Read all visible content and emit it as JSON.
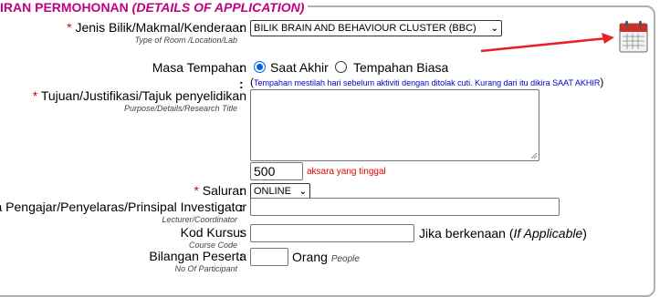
{
  "section": {
    "title": "IRAN PERMOHONAN",
    "title_en": "(DETAILS OF APPLICATION)"
  },
  "fields": {
    "room": {
      "label": "Jenis Bilik/Makmal/Kenderaan",
      "sublabel": "Type of Room /Location/Lab",
      "value": "BILIK BRAIN AND BEHAVIOUR CLUSTER (BBC)"
    },
    "booking": {
      "label": "Masa Tempahan",
      "option1": "Saat Akhir",
      "option2": "Tempahan Biasa",
      "selected": "Saat Akhir",
      "note_open": "(",
      "note": "Tempahan mestilah hari sebelum aktiviti dengan ditolak cuti. Kurang dari itu dikira SAAT AKHIR",
      "note_close": ")"
    },
    "purpose": {
      "label": "Tujuan/Justifikasi/Tajuk penyelidikan",
      "sublabel": "Purpose/Details/Research Title",
      "value": "",
      "chars_left": "500",
      "chars_label": "aksara yang tinggal"
    },
    "channel": {
      "label": "Saluran",
      "value": "ONLINE"
    },
    "lecturer": {
      "label": "a Pengajar/Penyelaras/Prinsipal Investigator",
      "sublabel": "Lecturer/Coordinator",
      "value": ""
    },
    "course": {
      "label": "Kod Kursus",
      "sublabel": "Course Code",
      "value": "",
      "suffix": "Jika berkenaan (",
      "suffix_en": "If Applicable",
      "suffix_close": ")"
    },
    "participants": {
      "label": "Bilangan Peserta",
      "sublabel": "No Of Participant",
      "value": "",
      "unit": "Orang",
      "unit_en": "People"
    }
  },
  "required_mark": "*",
  "colon": ":",
  "icons": {
    "calendar": "calendar-icon",
    "arrow": "red-arrow-icon"
  },
  "colors": {
    "accent": "#c00080",
    "required": "#e00000",
    "note": "#0000c8"
  }
}
